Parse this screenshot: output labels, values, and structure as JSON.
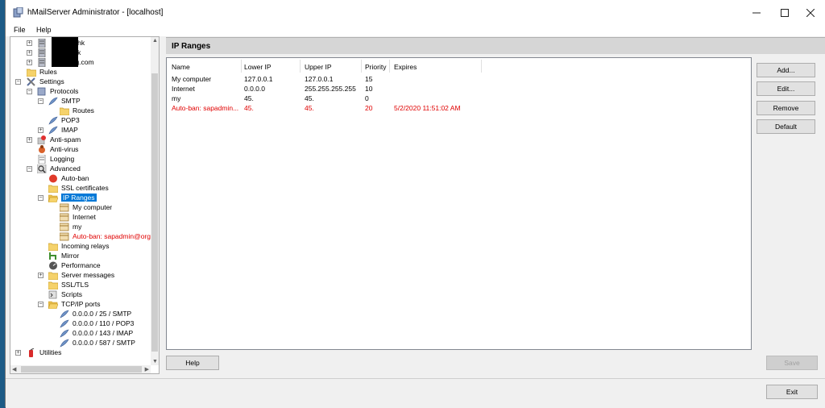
{
  "window": {
    "title": "hMailServer Administrator - [localhost]"
  },
  "menu": {
    "file": "File",
    "help": "Help"
  },
  "tree": {
    "domain_1_suffix": "g.hk",
    "domain_2_suffix": ".hk",
    "domain_3_suffix": "ong.com",
    "rules": "Rules",
    "settings": "Settings",
    "protocols": "Protocols",
    "smtp": "SMTP",
    "routes": "Routes",
    "pop3": "POP3",
    "imap": "IMAP",
    "antispam": "Anti-spam",
    "antivirus": "Anti-virus",
    "logging": "Logging",
    "advanced": "Advanced",
    "autoban": "Auto-ban",
    "ssl_certs": "SSL certificates",
    "ip_ranges": "IP Ranges",
    "my_computer": "My computer",
    "internet": "Internet",
    "my": "my",
    "autoban_entry": "Auto-ban: sapadmin@org.h",
    "incoming_relays": "Incoming relays",
    "mirror": "Mirror",
    "performance": "Performance",
    "server_messages": "Server messages",
    "ssl_tls": "SSL/TLS",
    "scripts": "Scripts",
    "tcpip_ports": "TCP/IP ports",
    "port_smtp_25": "0.0.0.0 / 25 / SMTP",
    "port_pop3_110": "0.0.0.0 / 110 / POP3",
    "port_imap_143": "0.0.0.0 / 143 / IMAP",
    "port_smtp_587": "0.0.0.0 / 587 / SMTP",
    "utilities": "Utilities"
  },
  "main": {
    "title": "IP Ranges",
    "columns": [
      "Name",
      "Lower IP",
      "Upper IP",
      "Priority",
      "Expires"
    ],
    "rows": [
      {
        "name": "My computer",
        "lower": "127.0.0.1",
        "upper": "127.0.0.1",
        "priority": "15",
        "expires": ""
      },
      {
        "name": "Internet",
        "lower": "0.0.0.0",
        "upper": "255.255.255.255",
        "priority": "10",
        "expires": ""
      },
      {
        "name": "my",
        "lower": "45.",
        "upper": "45.",
        "priority": "0",
        "expires": ""
      },
      {
        "name": "Auto-ban: sapadmin...",
        "lower": "45.",
        "upper": "45.",
        "priority": "20",
        "expires": "5/2/2020 11:51:02 AM"
      }
    ]
  },
  "buttons": {
    "add": "Add...",
    "edit": "Edit...",
    "remove": "Remove",
    "default": "Default",
    "help": "Help",
    "save": "Save",
    "exit": "Exit"
  },
  "colors": {
    "selection": "#0078d7",
    "autoban_red": "#e00000",
    "desktop": "#1d5b86"
  }
}
